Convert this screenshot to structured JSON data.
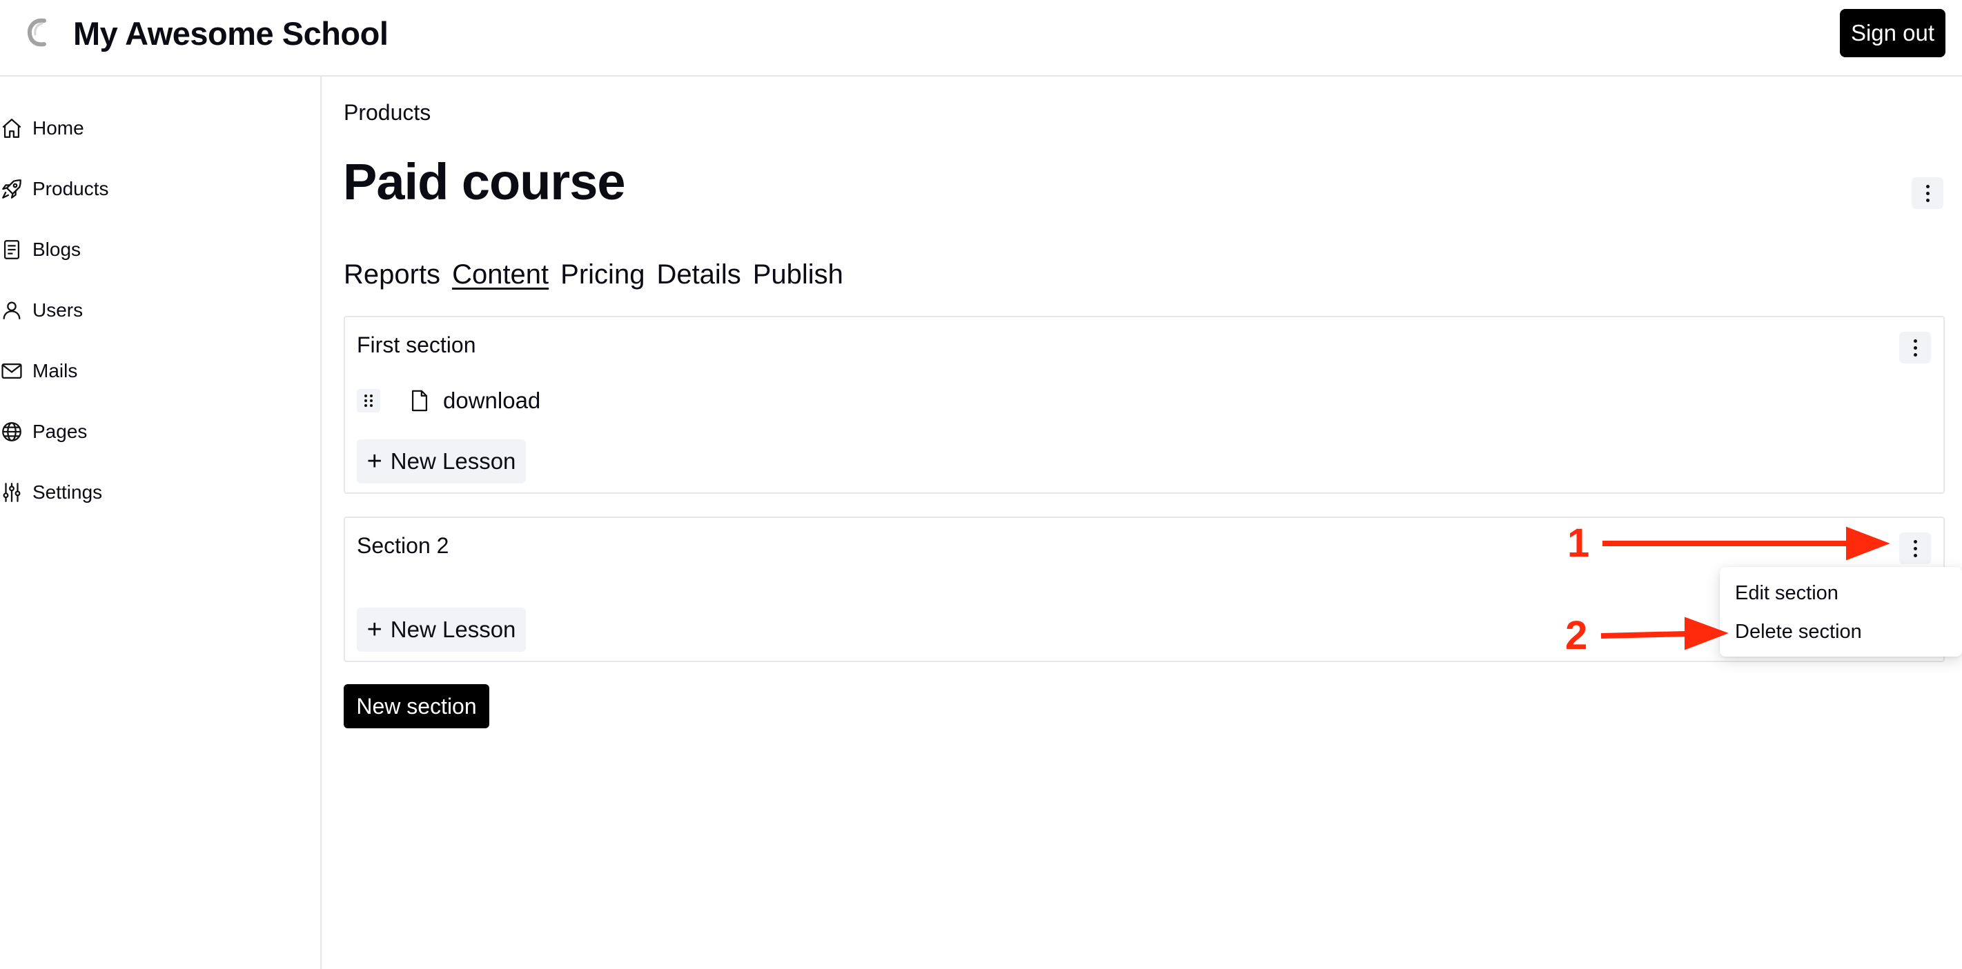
{
  "header": {
    "app_name": "My Awesome School",
    "signout_label": "Sign out"
  },
  "sidebar": {
    "items": [
      {
        "label": "Home",
        "icon": "home-icon"
      },
      {
        "label": "Products",
        "icon": "rocket-icon"
      },
      {
        "label": "Blogs",
        "icon": "document-icon"
      },
      {
        "label": "Users",
        "icon": "user-icon"
      },
      {
        "label": "Mails",
        "icon": "mail-icon"
      },
      {
        "label": "Pages",
        "icon": "globe-icon"
      },
      {
        "label": "Settings",
        "icon": "sliders-icon"
      }
    ]
  },
  "main": {
    "breadcrumb": "Products",
    "title": "Paid course",
    "tabs": [
      {
        "label": "Reports",
        "active": false
      },
      {
        "label": "Content",
        "active": true
      },
      {
        "label": "Pricing",
        "active": false
      },
      {
        "label": "Details",
        "active": false
      },
      {
        "label": "Publish",
        "active": false
      }
    ],
    "sections": [
      {
        "title": "First section",
        "lessons": [
          {
            "name": "download"
          }
        ],
        "new_lesson_label": "New Lesson"
      },
      {
        "title": "Section 2",
        "lessons": [],
        "new_lesson_label": "New Lesson"
      }
    ],
    "new_section_label": "New section"
  },
  "section_menu": {
    "items": [
      "Edit section",
      "Delete section"
    ]
  },
  "annotations": {
    "labels": [
      "1",
      "2"
    ],
    "color": "#ff2a0b"
  }
}
